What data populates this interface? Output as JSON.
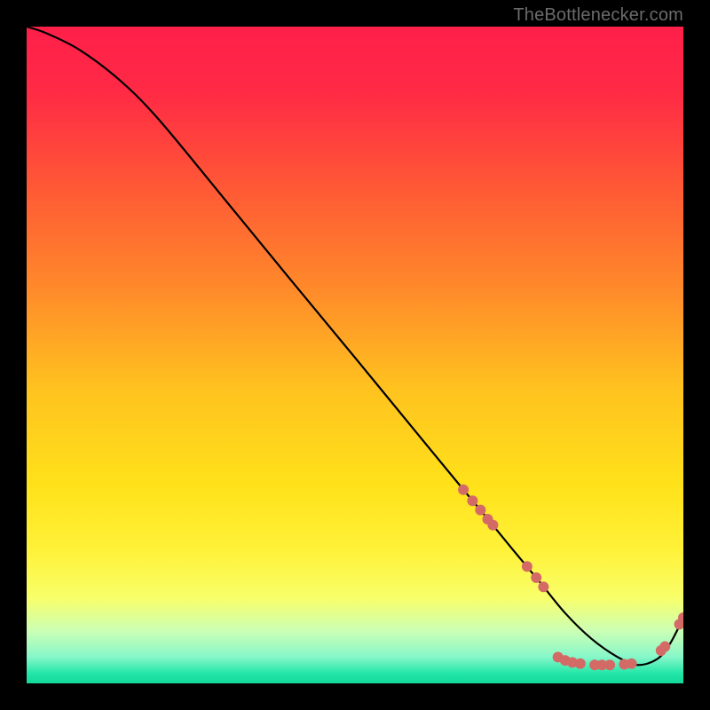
{
  "watermark": "TheBottlenecker.com",
  "gradient_stops": [
    {
      "offset": 0.0,
      "color": "#ff1f4a"
    },
    {
      "offset": 0.1,
      "color": "#ff2a45"
    },
    {
      "offset": 0.25,
      "color": "#ff5a35"
    },
    {
      "offset": 0.4,
      "color": "#ff8a2a"
    },
    {
      "offset": 0.55,
      "color": "#ffc21f"
    },
    {
      "offset": 0.7,
      "color": "#ffe21a"
    },
    {
      "offset": 0.8,
      "color": "#fff23a"
    },
    {
      "offset": 0.87,
      "color": "#f8ff6a"
    },
    {
      "offset": 0.92,
      "color": "#ccffb5"
    },
    {
      "offset": 0.96,
      "color": "#86f7c9"
    },
    {
      "offset": 0.985,
      "color": "#22e6a8"
    },
    {
      "offset": 1.0,
      "color": "#14d79a"
    }
  ],
  "chart_data": {
    "type": "line",
    "title": "",
    "xlabel": "",
    "ylabel": "",
    "x_range": [
      0,
      100
    ],
    "y_range": [
      0,
      100
    ],
    "series": [
      {
        "name": "curve",
        "stroke": "#000000",
        "x": [
          0,
          3,
          8,
          14,
          20,
          30,
          40,
          50,
          60,
          67,
          70,
          74,
          78,
          82,
          86,
          90,
          93,
          96,
          98,
          100
        ],
        "y": [
          100,
          99,
          96.5,
          92,
          86,
          73.9,
          61.7,
          49.6,
          37.4,
          28.9,
          25.3,
          20.4,
          15.6,
          10.7,
          6.8,
          4.0,
          2.8,
          3.7,
          6.1,
          10.0
        ]
      }
    ],
    "markers": [
      {
        "name": "dots",
        "color": "#d46a66",
        "radius_px": 6,
        "points": [
          {
            "x": 66.5,
            "y": 29.5
          },
          {
            "x": 67.9,
            "y": 27.8
          },
          {
            "x": 69.1,
            "y": 26.4
          },
          {
            "x": 70.2,
            "y": 25.0
          },
          {
            "x": 71.0,
            "y": 24.1
          },
          {
            "x": 76.2,
            "y": 17.8
          },
          {
            "x": 77.6,
            "y": 16.1
          },
          {
            "x": 78.7,
            "y": 14.7
          },
          {
            "x": 80.9,
            "y": 4.0
          },
          {
            "x": 82.0,
            "y": 3.5
          },
          {
            "x": 83.1,
            "y": 3.2
          },
          {
            "x": 84.3,
            "y": 3.0
          },
          {
            "x": 86.5,
            "y": 2.8
          },
          {
            "x": 87.6,
            "y": 2.8
          },
          {
            "x": 88.8,
            "y": 2.8
          },
          {
            "x": 91.0,
            "y": 2.9
          },
          {
            "x": 92.1,
            "y": 3.0
          },
          {
            "x": 96.6,
            "y": 5.0
          },
          {
            "x": 97.2,
            "y": 5.6
          },
          {
            "x": 99.4,
            "y": 9.0
          },
          {
            "x": 100.0,
            "y": 10.0
          }
        ]
      }
    ]
  }
}
